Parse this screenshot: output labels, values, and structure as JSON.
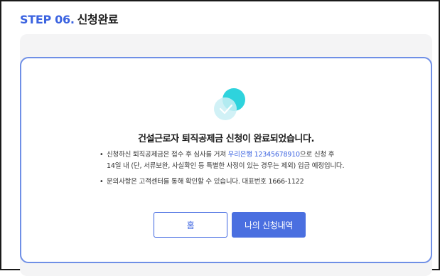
{
  "header": {
    "step_number": "STEP 06.",
    "step_name": "신청완료"
  },
  "result": {
    "icon": "check-circle-icon",
    "headline": "건설근로자 퇴직공제금 신청이 완료되었습니다.",
    "notes": [
      {
        "bullet": "•",
        "line1_prefix": "신청하신 퇴직공제금은 접수 후 심사를 거쳐 ",
        "bank_account": "우리은행 12345678910",
        "line1_suffix": "으로 신청 후",
        "line2": "14일 내 (단, 서류보완, 사실확인 등 특별한 사정이 있는 경우는 제외) 입금 예정입니다."
      },
      {
        "bullet": "•",
        "text": "문의사항은 고객센터를 통해 확인할 수 있습니다. 대표번호 1666-1122"
      }
    ]
  },
  "buttons": {
    "home_label": "홈",
    "history_label": "나의 신청내역"
  },
  "colors": {
    "accent": "#3b63e0",
    "card_border": "#6f8fe6",
    "icon_cyan": "#2ed3dd",
    "icon_light": "#bfeaf2"
  }
}
